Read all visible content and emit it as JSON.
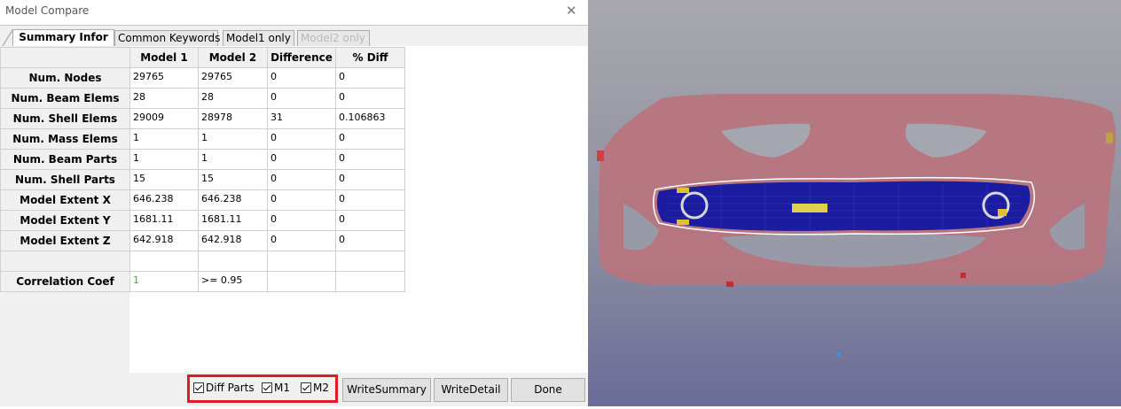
{
  "window": {
    "title": "Model Compare",
    "close_glyph": "✕"
  },
  "tabs": [
    {
      "label": "Summary Infor"
    },
    {
      "label": "Common Keywords"
    },
    {
      "label": "Model1 only"
    },
    {
      "label": "Model2 only"
    }
  ],
  "table": {
    "columns": [
      "Model 1",
      "Model 2",
      "Difference",
      "% Diff"
    ],
    "rows": [
      {
        "label": "Num. Nodes",
        "values": [
          "29765",
          "29765",
          "0",
          "0"
        ]
      },
      {
        "label": "Num. Beam Elems",
        "values": [
          "28",
          "28",
          "0",
          "0"
        ]
      },
      {
        "label": "Num. Shell Elems",
        "values": [
          "29009",
          "28978",
          "31",
          "0.106863"
        ]
      },
      {
        "label": "Num. Mass Elems",
        "values": [
          "1",
          "1",
          "0",
          "0"
        ]
      },
      {
        "label": "Num. Beam Parts",
        "values": [
          "1",
          "1",
          "0",
          "0"
        ]
      },
      {
        "label": "Num. Shell Parts",
        "values": [
          "15",
          "15",
          "0",
          "0"
        ]
      },
      {
        "label": "Model Extent X",
        "values": [
          "646.238",
          "646.238",
          "0",
          "0"
        ]
      },
      {
        "label": "Model Extent Y",
        "values": [
          "1681.11",
          "1681.11",
          "0",
          "0"
        ]
      },
      {
        "label": "Model Extent Z",
        "values": [
          "642.918",
          "642.918",
          "0",
          "0"
        ]
      },
      {
        "label": "",
        "values": [
          "",
          "",
          "",
          ""
        ]
      },
      {
        "label": "Correlation Coef",
        "values": [
          "1",
          ">= 0.95",
          "",
          ""
        ]
      }
    ]
  },
  "checkboxes": [
    {
      "label": "Diff Parts",
      "checked": true
    },
    {
      "label": "M1",
      "checked": true
    },
    {
      "label": "M2",
      "checked": true
    }
  ],
  "buttons": {
    "write_summary": "WriteSummary",
    "write_detail": "WriteDetail",
    "done": "Done"
  },
  "colors": {
    "bumper": "#b8747e",
    "mesh": "#1c1ca0",
    "highlight": "#e01b24",
    "coef_ok": "#2ab82a"
  }
}
